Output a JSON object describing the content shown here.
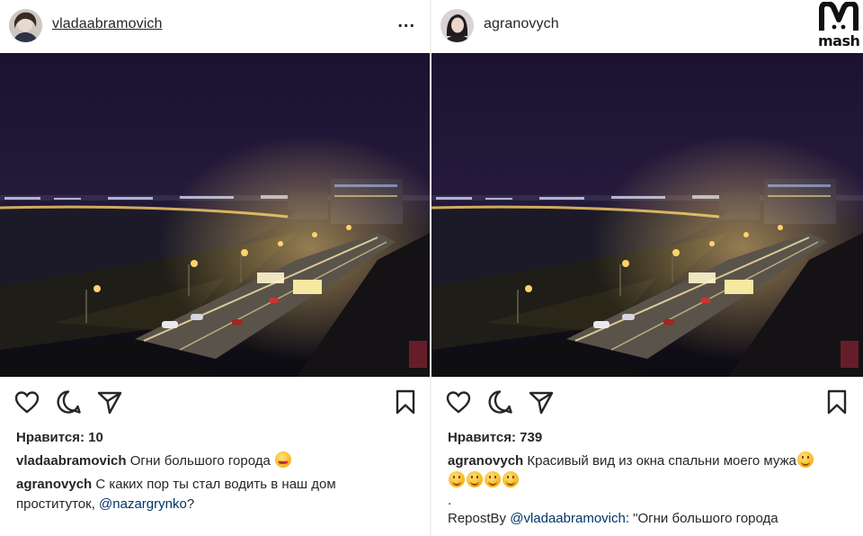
{
  "left_post": {
    "username": "vladaabramovich",
    "more_icon": "...",
    "likes_label": "Нравится: 10",
    "caption": {
      "username": "vladaabramovich",
      "text": "Огни большого города"
    },
    "comment": {
      "username": "agranovych",
      "text": "С каких пор ты стал водить в наш дом проституток,",
      "mention": "@nazargrynko",
      "suffix": "?"
    }
  },
  "right_post": {
    "username": "agranovych",
    "logo_text": "mash",
    "likes_label": "Нравится: 739",
    "caption": {
      "username": "agranovych",
      "text": "Красивый вид из окна спальни моего мужа"
    },
    "dot": ".",
    "repost": {
      "prefix": "RepostBy",
      "mention": "@vladaabramovich",
      "text": ": \"Огни большого города"
    }
  },
  "icons": {
    "like": "heart-icon",
    "comment": "comment-icon",
    "share": "share-icon",
    "save": "bookmark-icon"
  },
  "colors": {
    "mention": "#003569",
    "text": "#262626",
    "night_sky": "#1c1430",
    "street_light": "#ffd36b"
  }
}
